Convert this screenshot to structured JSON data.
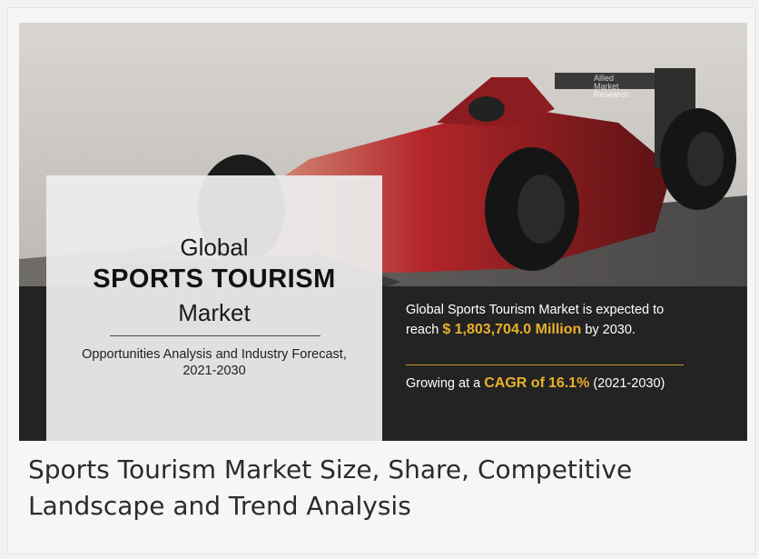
{
  "banner": {
    "heading_global": "Global",
    "heading_title": "SPORTS TOURISM",
    "heading_market": "Market",
    "subtitle_line1": "Opportunities Analysis and Industry Forecast,",
    "subtitle_line2": "2021-2030",
    "info_line1": "Global Sports Tourism Market is expected to",
    "info_reach": "reach",
    "info_value": "$ 1,803,704.0 Million",
    "info_year": "by 2030.",
    "cagr_prefix": "Growing at a",
    "cagr_label": "CAGR of",
    "cagr_value": "16.1%",
    "cagr_period": "(2021-2030)",
    "logo_line1": "Allied",
    "logo_line2": "Market",
    "logo_line3": "Research"
  },
  "caption": {
    "title": "Sports Tourism Market Size, Share, Competitive Landscape and Trend Analysis"
  },
  "colors": {
    "accent_gold": "#e9b02a",
    "dark_band": "#232323",
    "car_red": "#b3262a"
  }
}
